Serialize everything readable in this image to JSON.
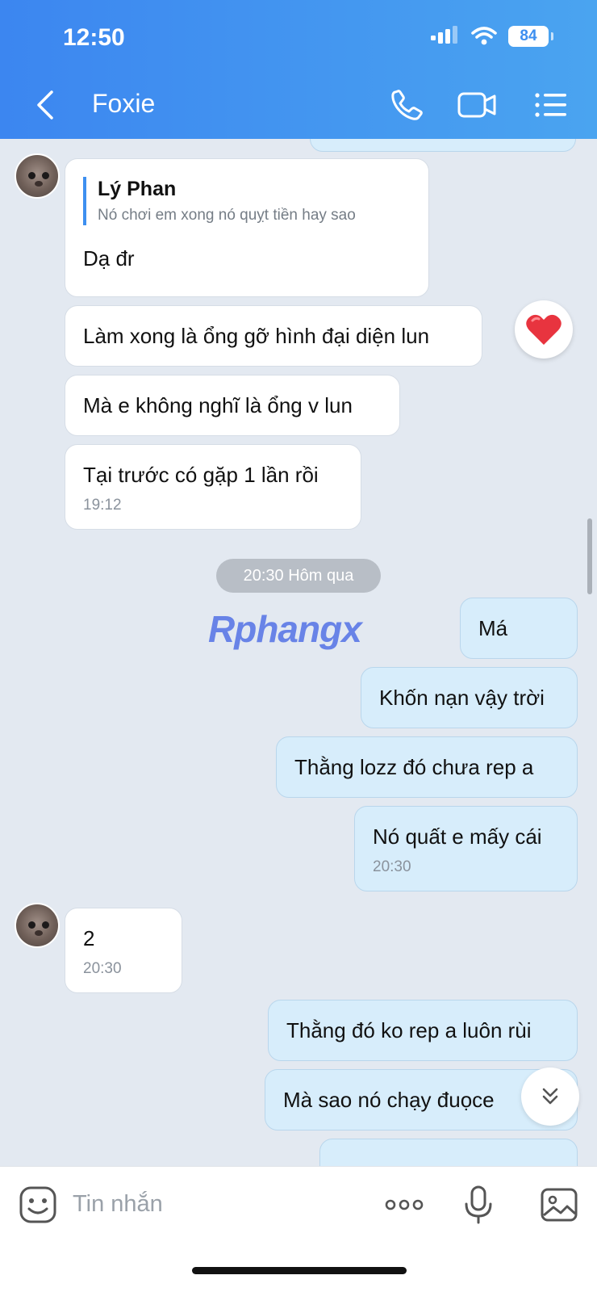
{
  "status_bar": {
    "time": "12:50",
    "battery": "84"
  },
  "header": {
    "title": "Foxie"
  },
  "messages": [
    {
      "quote_author": "Lý Phan",
      "quote_text": "Nó chơi em xong nó quỵt tiền hay sao",
      "text": "Dạ đr"
    },
    {
      "text": "Làm xong là ổng gỡ hình đại diện lun",
      "reaction": "❤"
    },
    {
      "text": "Mà e không nghĩ là ổng v lun"
    },
    {
      "text": "Tại trước có gặp 1 lần rồi",
      "time": "19:12"
    },
    {
      "text": "Má"
    },
    {
      "text": "Khốn nạn vậy trời"
    },
    {
      "text": "Thằng lozz đó chưa rep a"
    },
    {
      "text": "Nó quất e mấy cái",
      "time": "20:30"
    },
    {
      "text": "2",
      "time": "20:30"
    },
    {
      "text": "Thằng đó ko rep a luôn rùi"
    },
    {
      "text": "Mà sao nó chạy đuọce"
    }
  ],
  "date_separator": "20:30 Hôm qua",
  "watermark": "Rphangx",
  "input": {
    "placeholder": "Tin nhắn"
  },
  "colors": {
    "header_start": "#3c86f0",
    "header_end": "#4aa4f0",
    "outgoing_bubble": "#d7edfb",
    "incoming_bubble": "#ffffff",
    "chat_background": "#e3e9f1",
    "reaction_heart": "#e8343f"
  },
  "icons": [
    "back-arrow-icon",
    "phone-icon",
    "video-call-icon",
    "list-menu-icon",
    "signal-icon",
    "wifi-icon",
    "heart-icon",
    "chevron-double-down-icon",
    "sticker-icon",
    "more-icon",
    "microphone-icon",
    "image-icon"
  ]
}
